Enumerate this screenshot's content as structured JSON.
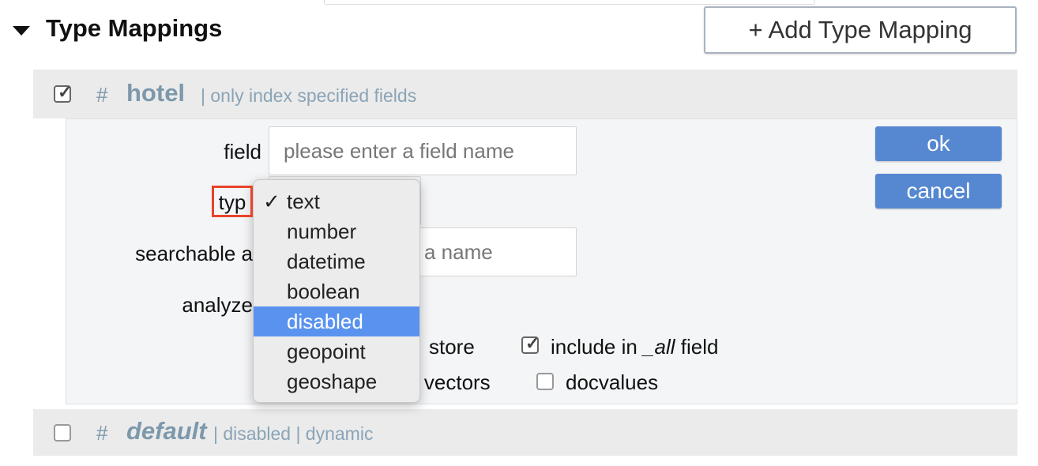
{
  "section": {
    "title": "Type Mappings",
    "add_button": "+ Add Type Mapping"
  },
  "mappings": [
    {
      "name": "hotel",
      "checked": true,
      "description": "only index specified fields"
    },
    {
      "name": "default",
      "checked": false,
      "description": "disabled | dynamic"
    }
  ],
  "form": {
    "field_label": "field",
    "field_placeholder": "please enter a field name",
    "type_label": "typ",
    "searchable_label": "searchable a",
    "searchable_placeholder": "a name",
    "analyzer_label": "analyze",
    "store_label": "store",
    "term_vectors_label": "m vectors",
    "include_all_label_pre": "include in ",
    "include_all_label_em": "_all",
    "include_all_label_post": " field",
    "include_all_checked": true,
    "docvalues_label": "docvalues",
    "docvalues_checked": false,
    "ok_button": "ok",
    "cancel_button": "cancel"
  },
  "type_dropdown": {
    "selected": "text",
    "highlighted": "disabled",
    "check_glyph": "✓",
    "options": [
      "text",
      "number",
      "datetime",
      "boolean",
      "disabled",
      "geopoint",
      "geoshape"
    ]
  },
  "colors": {
    "accent": "#5588d0",
    "highlight": "#5a93ef",
    "annotation": "#e8432a"
  }
}
